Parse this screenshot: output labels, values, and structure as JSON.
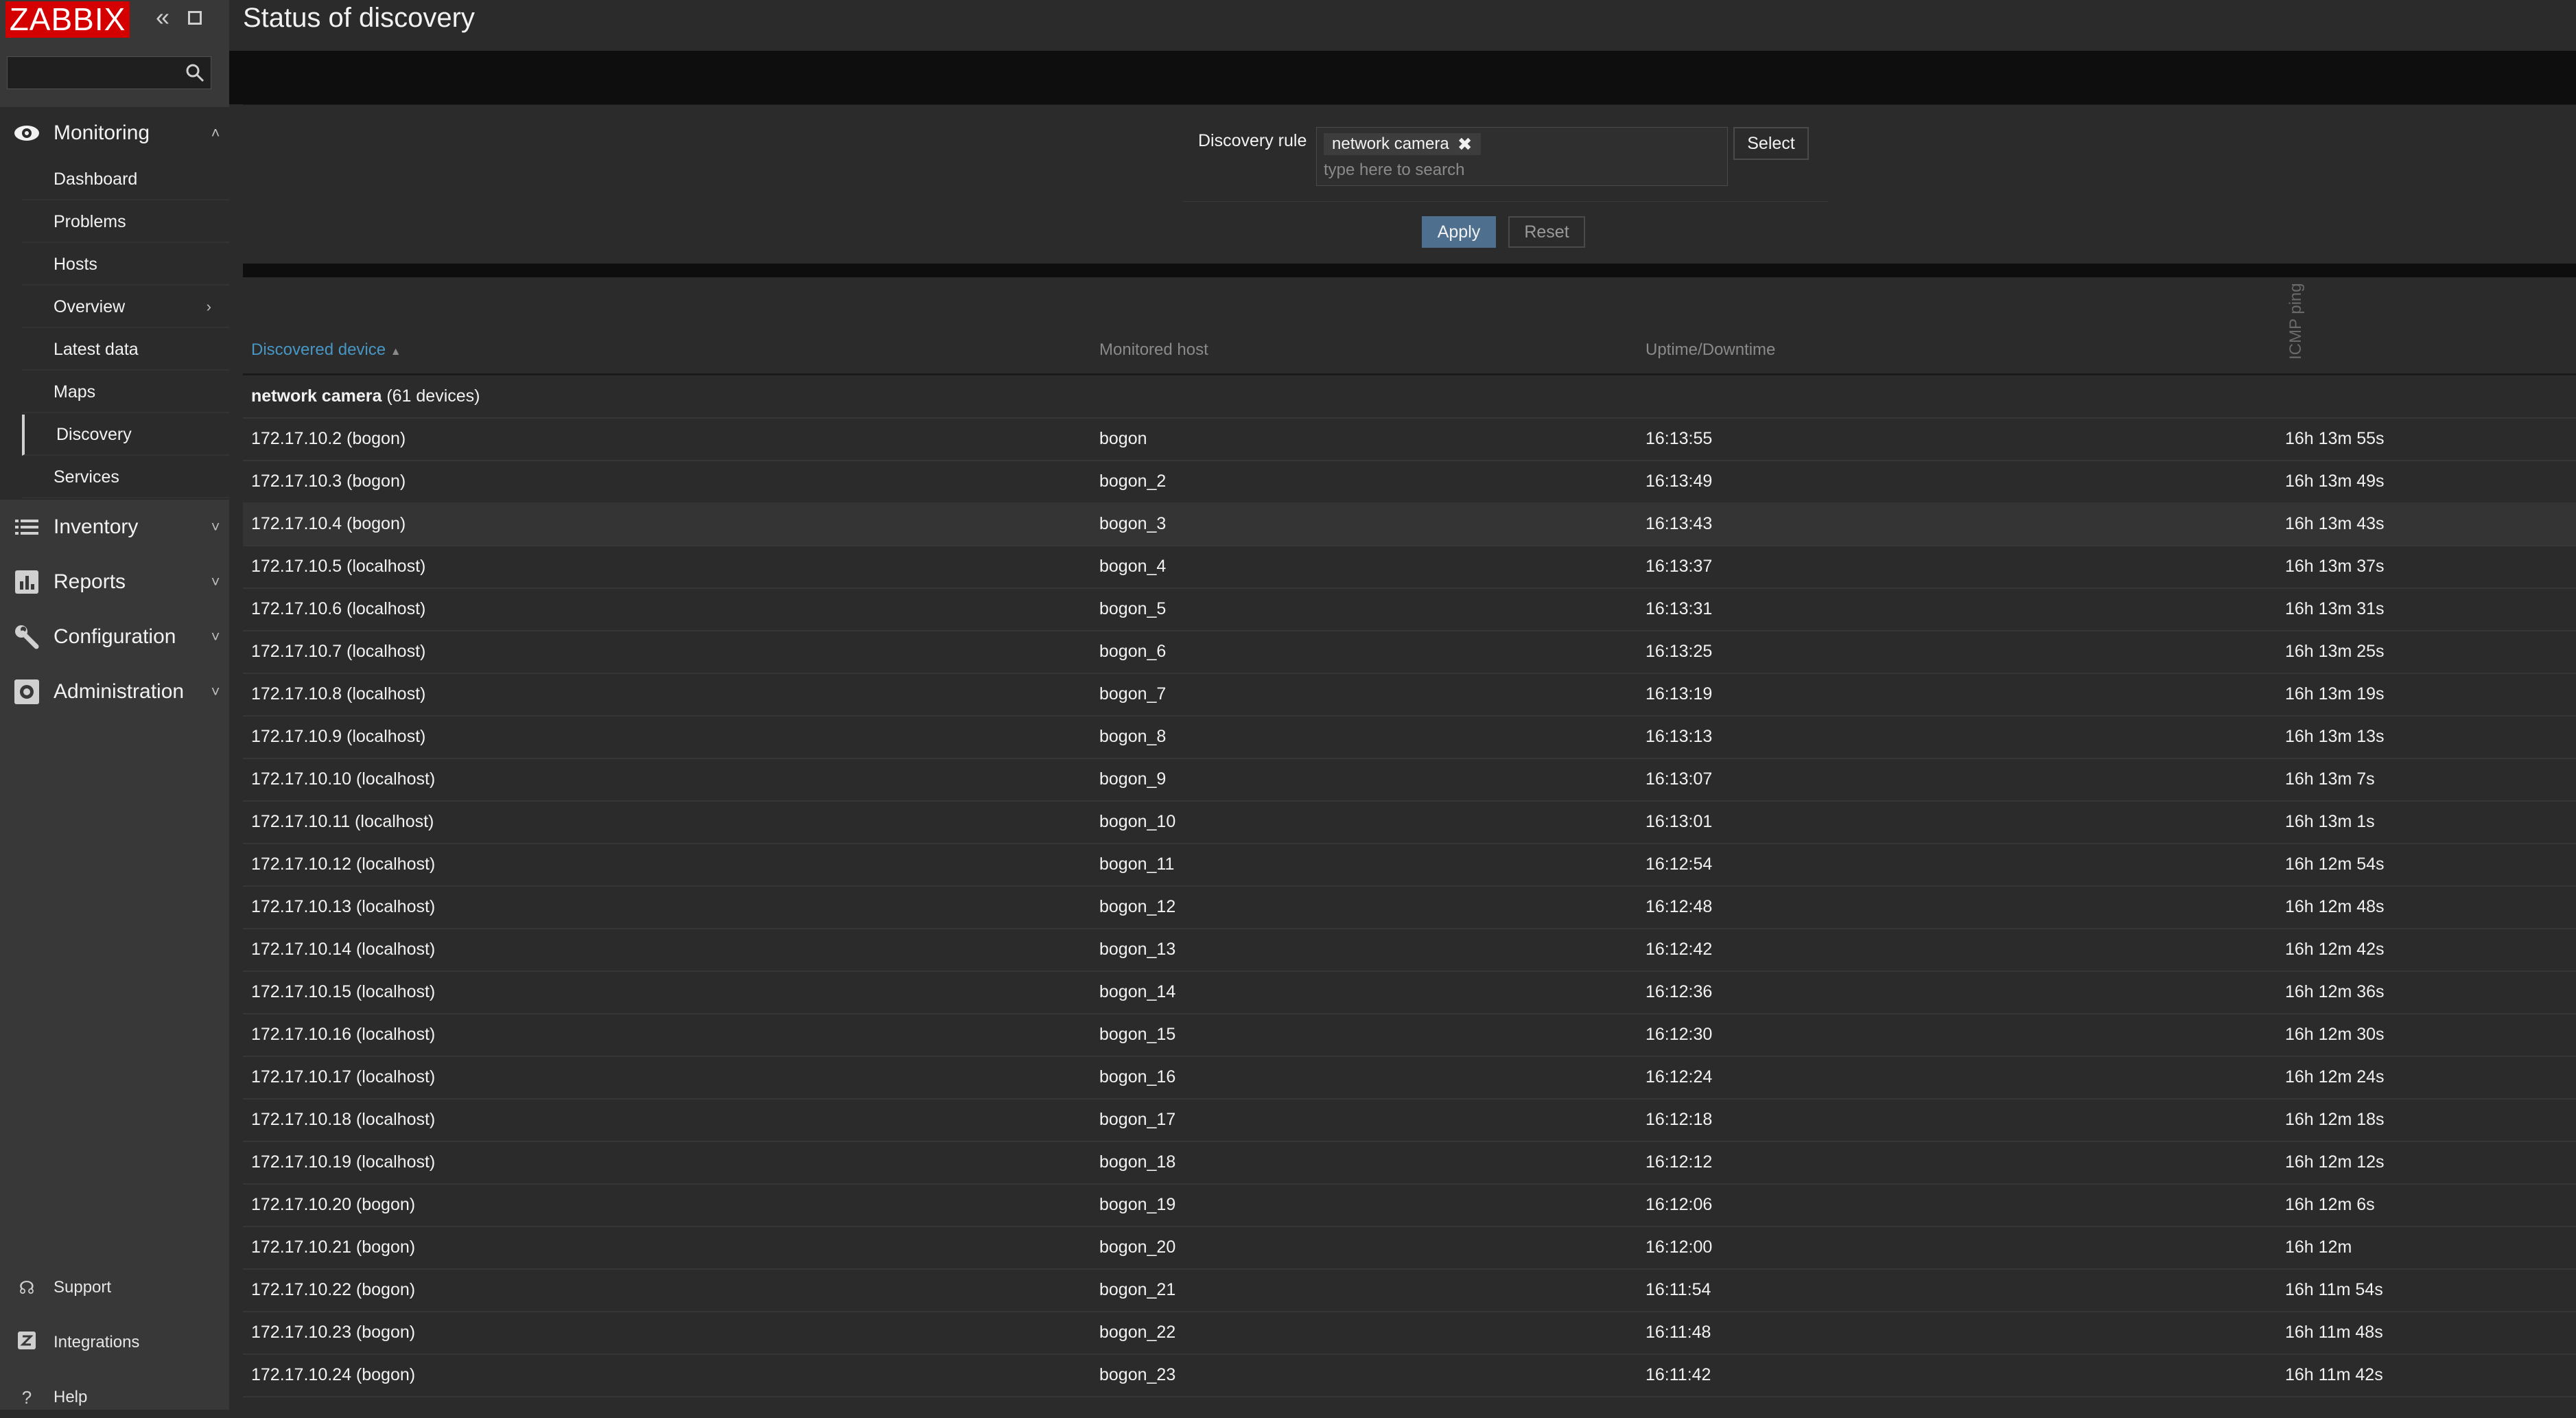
{
  "app": {
    "logo_text": "ZABBIX",
    "page_title": "Status of discovery"
  },
  "sidebar": {
    "search_placeholder": "",
    "sections": {
      "monitoring": "Monitoring",
      "inventory": "Inventory",
      "reports": "Reports",
      "configuration": "Configuration",
      "administration": "Administration"
    },
    "monitoring_items": [
      "Dashboard",
      "Problems",
      "Hosts",
      "Overview",
      "Latest data",
      "Maps",
      "Discovery",
      "Services"
    ],
    "active_item": "Discovery",
    "footer": {
      "support": "Support",
      "integrations": "Integrations",
      "help": "Help"
    }
  },
  "filter": {
    "rule_label": "Discovery rule",
    "selected_rule": "network camera",
    "placeholder": "type here to search",
    "select_label": "Select",
    "apply_label": "Apply",
    "reset_label": "Reset"
  },
  "table": {
    "columns": {
      "device": "Discovered device",
      "host": "Monitored host",
      "uptime": "Uptime/Downtime",
      "icmp": "ICMP ping"
    },
    "sort_indicator": "▲",
    "group": {
      "name": "network camera",
      "count": "(61 devices)"
    },
    "rows": [
      {
        "device": "172.17.10.2 (bogon)",
        "host": "bogon",
        "uptime": "16:13:55",
        "icmp": "16h 13m 55s"
      },
      {
        "device": "172.17.10.3 (bogon)",
        "host": "bogon_2",
        "uptime": "16:13:49",
        "icmp": "16h 13m 49s"
      },
      {
        "device": "172.17.10.4 (bogon)",
        "host": "bogon_3",
        "uptime": "16:13:43",
        "icmp": "16h 13m 43s"
      },
      {
        "device": "172.17.10.5 (localhost)",
        "host": "bogon_4",
        "uptime": "16:13:37",
        "icmp": "16h 13m 37s"
      },
      {
        "device": "172.17.10.6 (localhost)",
        "host": "bogon_5",
        "uptime": "16:13:31",
        "icmp": "16h 13m 31s"
      },
      {
        "device": "172.17.10.7 (localhost)",
        "host": "bogon_6",
        "uptime": "16:13:25",
        "icmp": "16h 13m 25s"
      },
      {
        "device": "172.17.10.8 (localhost)",
        "host": "bogon_7",
        "uptime": "16:13:19",
        "icmp": "16h 13m 19s"
      },
      {
        "device": "172.17.10.9 (localhost)",
        "host": "bogon_8",
        "uptime": "16:13:13",
        "icmp": "16h 13m 13s"
      },
      {
        "device": "172.17.10.10 (localhost)",
        "host": "bogon_9",
        "uptime": "16:13:07",
        "icmp": "16h 13m 7s"
      },
      {
        "device": "172.17.10.11 (localhost)",
        "host": "bogon_10",
        "uptime": "16:13:01",
        "icmp": "16h 13m 1s"
      },
      {
        "device": "172.17.10.12 (localhost)",
        "host": "bogon_11",
        "uptime": "16:12:54",
        "icmp": "16h 12m 54s"
      },
      {
        "device": "172.17.10.13 (localhost)",
        "host": "bogon_12",
        "uptime": "16:12:48",
        "icmp": "16h 12m 48s"
      },
      {
        "device": "172.17.10.14 (localhost)",
        "host": "bogon_13",
        "uptime": "16:12:42",
        "icmp": "16h 12m 42s"
      },
      {
        "device": "172.17.10.15 (localhost)",
        "host": "bogon_14",
        "uptime": "16:12:36",
        "icmp": "16h 12m 36s"
      },
      {
        "device": "172.17.10.16 (localhost)",
        "host": "bogon_15",
        "uptime": "16:12:30",
        "icmp": "16h 12m 30s"
      },
      {
        "device": "172.17.10.17 (localhost)",
        "host": "bogon_16",
        "uptime": "16:12:24",
        "icmp": "16h 12m 24s"
      },
      {
        "device": "172.17.10.18 (localhost)",
        "host": "bogon_17",
        "uptime": "16:12:18",
        "icmp": "16h 12m 18s"
      },
      {
        "device": "172.17.10.19 (localhost)",
        "host": "bogon_18",
        "uptime": "16:12:12",
        "icmp": "16h 12m 12s"
      },
      {
        "device": "172.17.10.20 (bogon)",
        "host": "bogon_19",
        "uptime": "16:12:06",
        "icmp": "16h 12m 6s"
      },
      {
        "device": "172.17.10.21 (bogon)",
        "host": "bogon_20",
        "uptime": "16:12:00",
        "icmp": "16h 12m"
      },
      {
        "device": "172.17.10.22 (bogon)",
        "host": "bogon_21",
        "uptime": "16:11:54",
        "icmp": "16h 11m 54s"
      },
      {
        "device": "172.17.10.23 (bogon)",
        "host": "bogon_22",
        "uptime": "16:11:48",
        "icmp": "16h 11m 48s"
      },
      {
        "device": "172.17.10.24 (bogon)",
        "host": "bogon_23",
        "uptime": "16:11:42",
        "icmp": "16h 11m 42s"
      }
    ],
    "highlighted_row": "172.17.10.4 (bogon)"
  },
  "colors": {
    "brand_red": "#d40000",
    "link_blue": "#4796c4",
    "apply_blue": "#4f6f8f",
    "background": "#2b2b2b",
    "sidebar": "#383838"
  },
  "icons": [
    "collapse-sidebar-icon",
    "kiosk-mode-icon",
    "search-icon",
    "eye-icon",
    "list-icon",
    "bar-chart-icon",
    "wrench-icon",
    "gear-icon",
    "headset-icon",
    "zabbix-z-icon",
    "help-icon",
    "chevron-up-icon",
    "chevron-down-icon",
    "chevron-right-icon",
    "remove-x-icon"
  ]
}
